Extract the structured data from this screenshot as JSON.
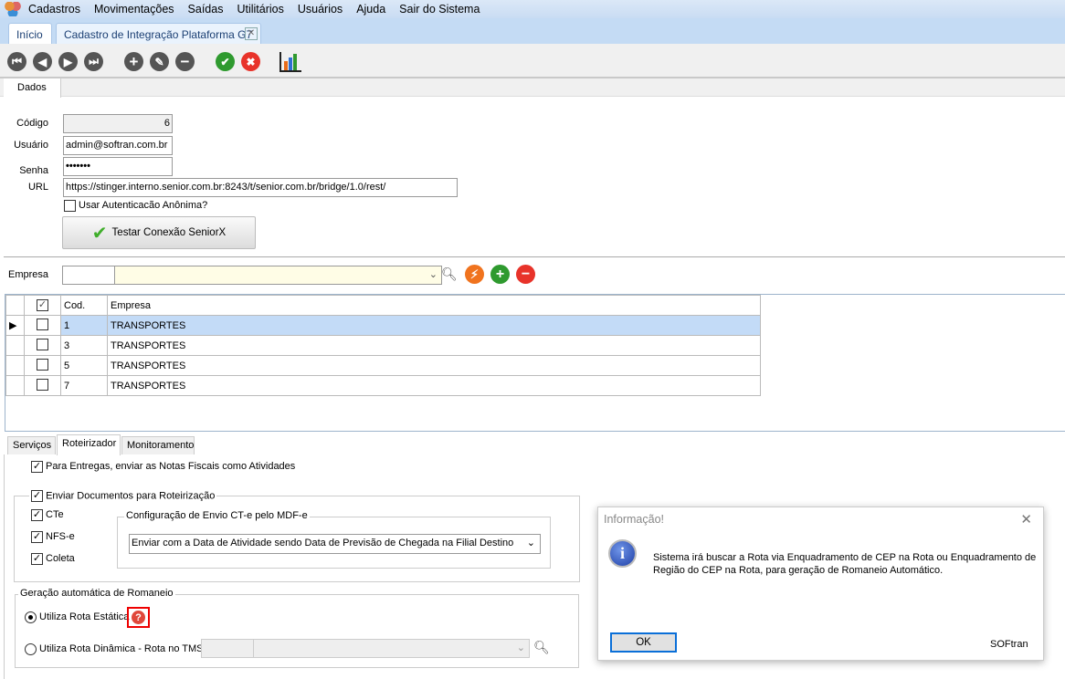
{
  "menu": [
    "Cadastros",
    "Movimentações",
    "Saídas",
    "Utilitários",
    "Usuários",
    "Ajuda",
    "Sair do Sistema"
  ],
  "doc_tabs": {
    "home": "Início",
    "active": "Cadastro de Integração Plataforma G7"
  },
  "form_tab": "Dados",
  "form": {
    "codigo_label": "Código",
    "codigo": "6",
    "usuario_label": "Usuário",
    "usuario": "admin@softran.com.br",
    "senha_label": "Senha",
    "senha": "•••••••",
    "url_label": "URL",
    "url": "https://stinger.interno.senior.com.br:8243/t/senior.com.br/bridge/1.0/rest/",
    "anon_label": "Usar Autenticacão Anônima?",
    "test_button": "Testar Conexão SeniorX",
    "empresa_label": "Empresa"
  },
  "grid": {
    "headers": [
      "Cod.",
      "Empresa"
    ],
    "rows": [
      {
        "cod": "1",
        "empresa": "TRANSPORTES"
      },
      {
        "cod": "3",
        "empresa": "TRANSPORTES"
      },
      {
        "cod": "5",
        "empresa": "TRANSPORTES"
      },
      {
        "cod": "7",
        "empresa": "TRANSPORTES"
      }
    ]
  },
  "bottom_tabs": [
    "Serviços",
    "Roteirizador",
    "Monitoramento"
  ],
  "rot": {
    "notas": "Para Entregas, enviar as Notas Fiscais como Atividades",
    "enviar_docs": "Enviar Documentos para Roteirização",
    "cte": "CTe",
    "nfse": "NFS-e",
    "coleta": "Coleta",
    "config_label": "Configuração de Envio CT-e pelo MDF-e",
    "config_value": "Enviar com a Data de Atividade sendo Data de Previsão de Chegada na Filial Destino",
    "romaneio_label": "Geração automática de Romaneio",
    "estatica": "Utiliza Rota Estática",
    "dinamica": "Utiliza Rota Dinâmica - Rota no TMS:"
  },
  "dialog": {
    "title": "Informação!",
    "message": "Sistema irá buscar a Rota via Enquadramento de CEP na Rota ou Enquadramento de Região do CEP na Rota, para geração de Romaneio Automático.",
    "ok": "OK",
    "brand": "SOFtran"
  }
}
